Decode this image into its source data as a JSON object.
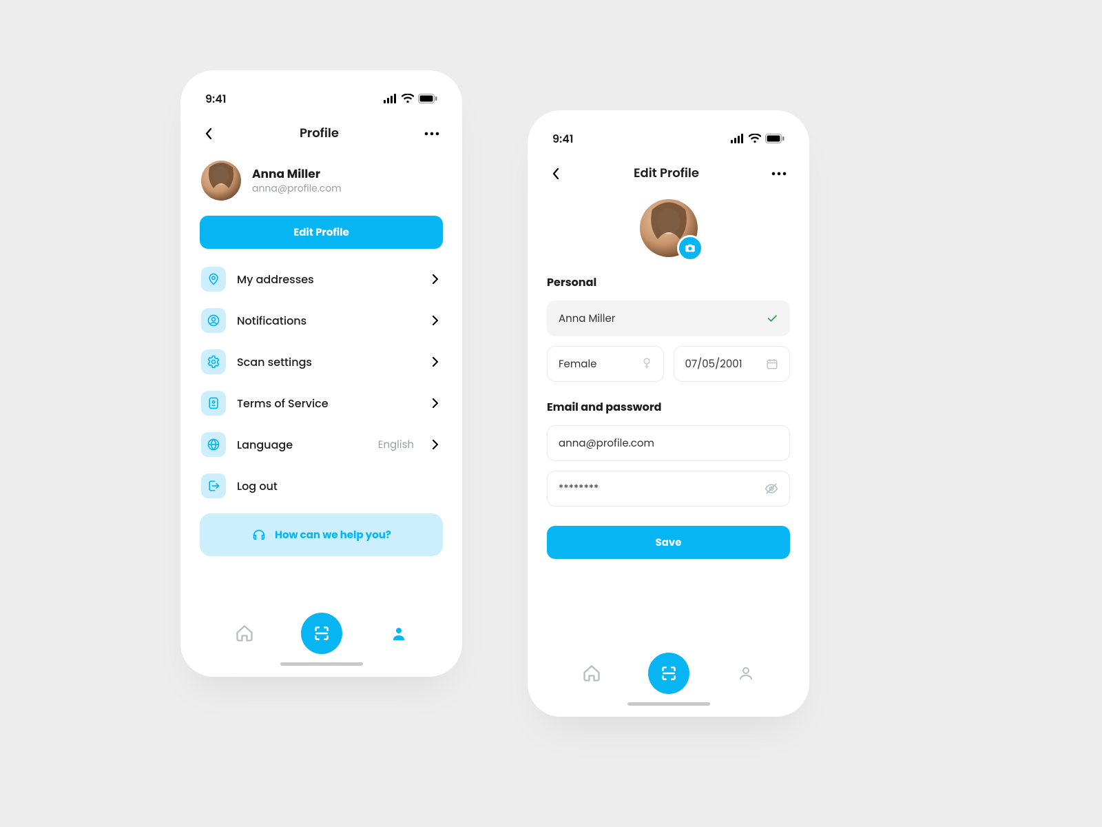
{
  "status": {
    "time": "9:41"
  },
  "left": {
    "title": "Profile",
    "user": {
      "name": "Anna Miller",
      "email": "anna@profile.com"
    },
    "editBtn": "Edit Profile",
    "menu": {
      "addresses": "My addresses",
      "notifications": "Notifications",
      "scan": "Scan settings",
      "tos": "Terms of Service",
      "language": "Language",
      "languageValue": "English",
      "logout": "Log out"
    },
    "help": "How can we help you?"
  },
  "right": {
    "title": "Edit Profile",
    "sections": {
      "personal": "Personal",
      "credentials": "Email and password"
    },
    "fields": {
      "name": "Anna Miller",
      "gender": "Female",
      "dob": "07/05/2001",
      "email": "anna@profile.com",
      "password": "********"
    },
    "saveBtn": "Save"
  },
  "colors": {
    "accent": "#07B5F3"
  }
}
